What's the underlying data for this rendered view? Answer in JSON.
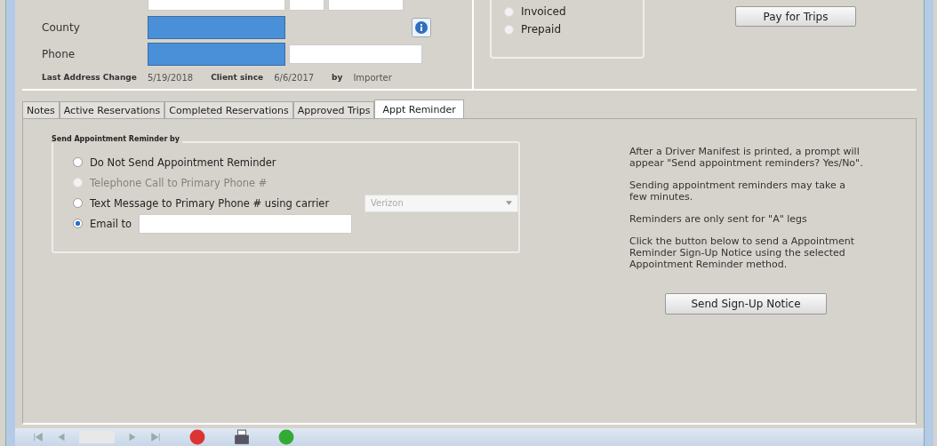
{
  "client": {
    "county_label": "County",
    "phone_label": "Phone",
    "last_change_label": "Last Address Change",
    "last_change": "5/19/2018",
    "client_since_label": "Client since",
    "client_since": "6/6/2017",
    "by_label": "by",
    "by": "Importer"
  },
  "billing": {
    "options": [
      {
        "label": "Invoiced",
        "selected": false
      },
      {
        "label": "Prepaid",
        "selected": false
      }
    ],
    "pay_button": "Pay for Trips"
  },
  "tabs": [
    {
      "label": "Notes",
      "selected": false
    },
    {
      "label": "Active Reservations",
      "selected": false
    },
    {
      "label": "Completed Reservations",
      "selected": false
    },
    {
      "label": "Approved Trips",
      "selected": false
    },
    {
      "label": "Appt Reminder",
      "selected": true
    }
  ],
  "reminder": {
    "group_title": "Send Appointment Reminder by",
    "options": [
      {
        "kind": "radio",
        "label": "Do Not Send Appointment Reminder",
        "selected": false,
        "disabled": false
      },
      {
        "kind": "radio",
        "label": "Telephone Call to Primary Phone #",
        "selected": false,
        "disabled": true
      },
      {
        "kind": "carrier",
        "label": "Text Message to Primary Phone # using carrier",
        "selected": false,
        "disabled": false,
        "carrier": "Verizon"
      },
      {
        "kind": "email",
        "label": "Email to",
        "selected": true,
        "disabled": false
      }
    ],
    "info": [
      "After a Driver Manifest is printed, a prompt will appear \"Send appointment reminders? Yes/No\".",
      "Sending appointment reminders may take a few minutes.",
      "Reminders are only sent for \"A\" legs",
      "Click the button below to send a Appointment Reminder Sign-Up Notice using the selected Appointment Reminder method."
    ],
    "signup_button": "Send Sign-Up Notice"
  }
}
